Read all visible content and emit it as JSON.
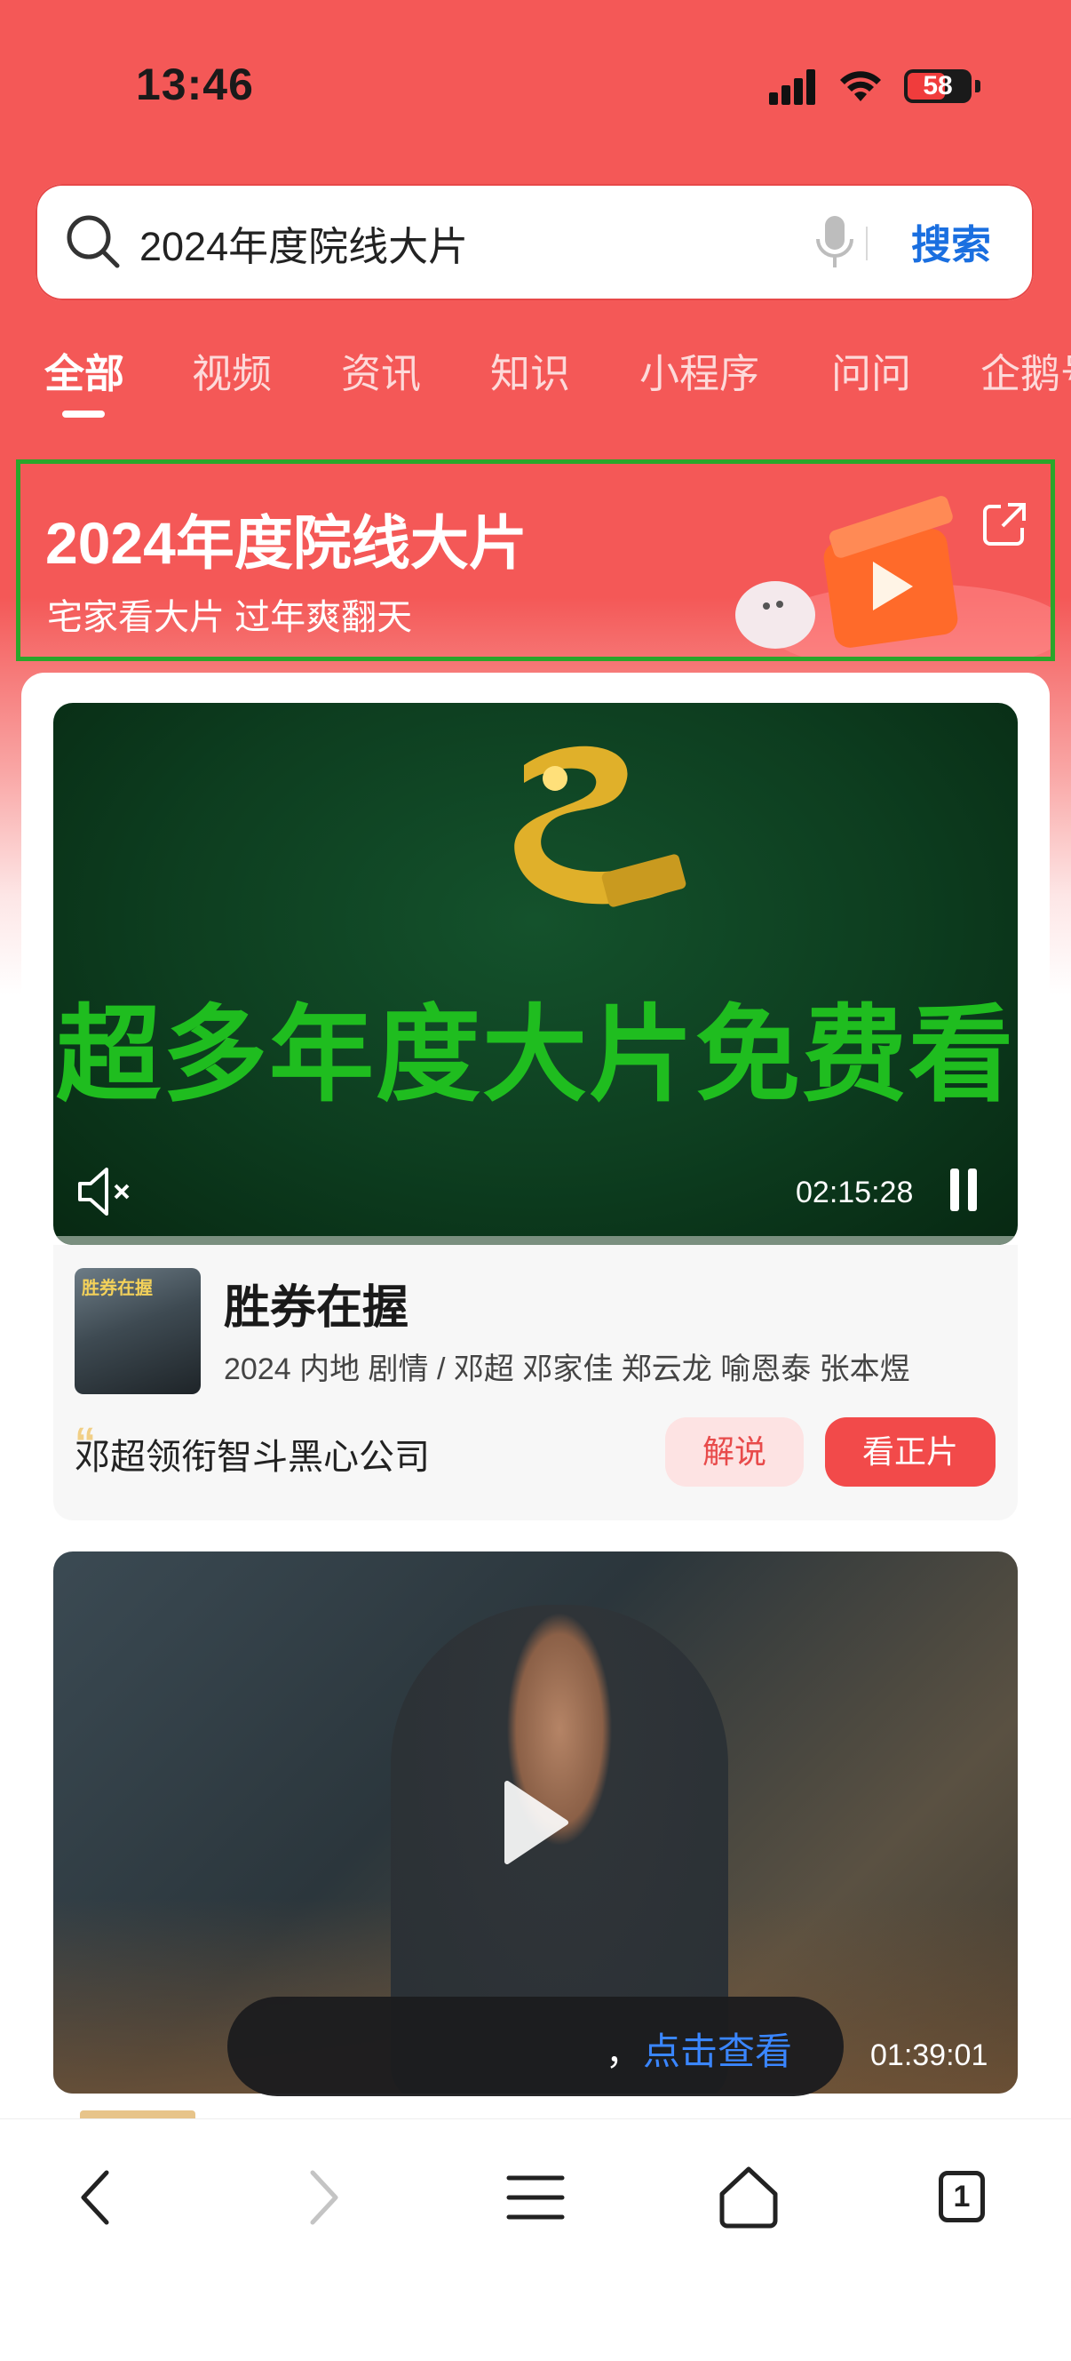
{
  "status_bar": {
    "time": "13:46",
    "battery": "58"
  },
  "search": {
    "query": "2024年度院线大片",
    "button": "搜索"
  },
  "tabs": [
    {
      "label": "全部",
      "active": true
    },
    {
      "label": "视频",
      "active": false
    },
    {
      "label": "资讯",
      "active": false
    },
    {
      "label": "知识",
      "active": false
    },
    {
      "label": "小程序",
      "active": false
    },
    {
      "label": "问问",
      "active": false
    },
    {
      "label": "企鹅号",
      "active": false
    }
  ],
  "banner": {
    "title": "2024年度院线大片",
    "subtitle": "宅家看大片 过年爽翻天"
  },
  "video1": {
    "overlay_text": "超多年度大片免费看",
    "duration": "02:15:28"
  },
  "movie1": {
    "title": "胜券在握",
    "meta": "2024 内地 剧情 / 邓超 邓家佳 郑云龙 喻恩泰 张本煜",
    "poster_text": "胜券在握",
    "tagline": "邓超领衔智斗黑心公司",
    "btn_explain": "解说",
    "btn_watch": "看正片"
  },
  "video2": {
    "duration": "01:39:01"
  },
  "toast": {
    "comma": "，",
    "link": "点击查看"
  },
  "bottom_nav": {
    "tab_count": "1"
  },
  "colors": {
    "brand_red": "#f45857",
    "search_blue": "#1a6fe0",
    "link_blue": "#3a86ff",
    "highlight_green": "#2aa62a"
  }
}
